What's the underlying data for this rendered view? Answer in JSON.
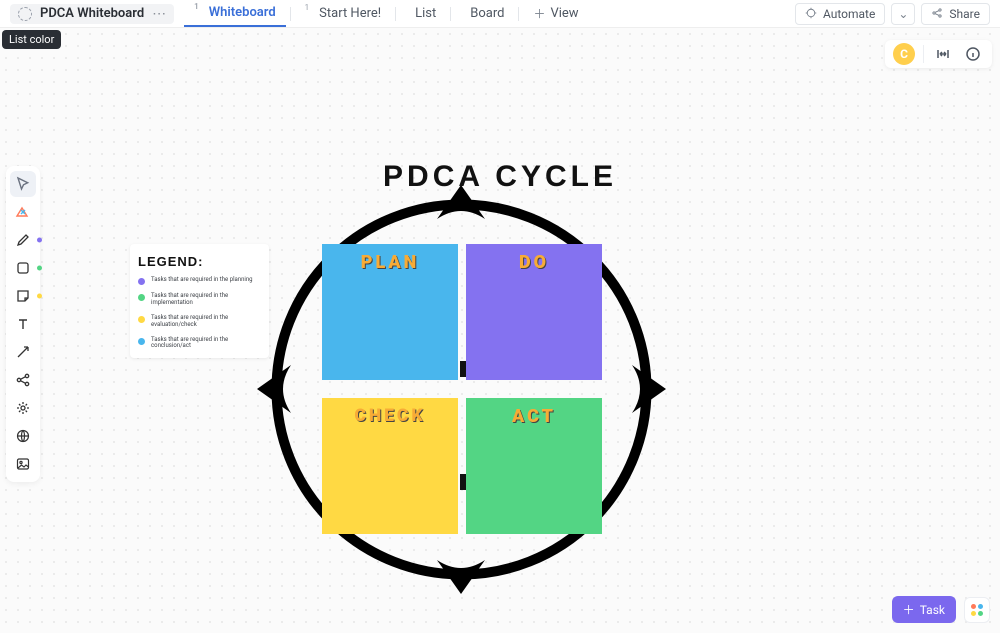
{
  "tooltip": "List color",
  "topbar": {
    "title": "PDCA Whiteboard",
    "tabs": [
      {
        "id": "whiteboard",
        "label": "Whiteboard",
        "active": true,
        "badge": "1"
      },
      {
        "id": "start-here",
        "label": "Start Here!",
        "active": false,
        "badge": "1"
      },
      {
        "id": "list",
        "label": "List",
        "active": false
      },
      {
        "id": "board",
        "label": "Board",
        "active": false
      }
    ],
    "view": "View",
    "automate": "Automate",
    "share": "Share"
  },
  "avatar_initial": "C",
  "task_button": "Task",
  "whiteboard": {
    "title": "PDCA CYCLE",
    "quads": {
      "plan": "PLAN",
      "do": "DO",
      "check": "CHECK",
      "act": "ACT"
    }
  },
  "legend": {
    "header": "LEGEND:",
    "items": [
      {
        "color": "#8472f0",
        "text": "Tasks that are required in the planning"
      },
      {
        "color": "#53d584",
        "text": "Tasks that are required in the implementation"
      },
      {
        "color": "#ffd943",
        "text": "Tasks that are required in the evaluation/check"
      },
      {
        "color": "#49b6ed",
        "text": "Tasks that are required in the conclusion/act"
      }
    ]
  },
  "tool_dots": {
    "pen": "#8472f0",
    "square": "#53d584",
    "sticky": "#ffd943"
  }
}
